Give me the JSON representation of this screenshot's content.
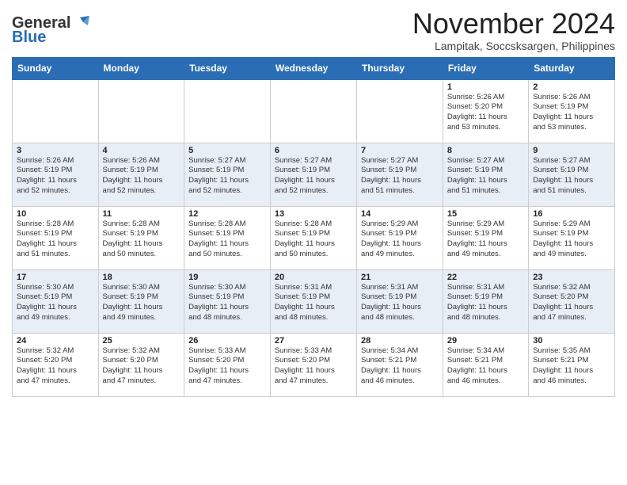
{
  "header": {
    "logo_line1": "General",
    "logo_line2": "Blue",
    "month_title": "November 2024",
    "location": "Lampitak, Soccsksargen, Philippines"
  },
  "columns": [
    "Sunday",
    "Monday",
    "Tuesday",
    "Wednesday",
    "Thursday",
    "Friday",
    "Saturday"
  ],
  "weeks": [
    [
      {
        "day": "",
        "info": ""
      },
      {
        "day": "",
        "info": ""
      },
      {
        "day": "",
        "info": ""
      },
      {
        "day": "",
        "info": ""
      },
      {
        "day": "",
        "info": ""
      },
      {
        "day": "1",
        "info": "Sunrise: 5:26 AM\nSunset: 5:20 PM\nDaylight: 11 hours\nand 53 minutes."
      },
      {
        "day": "2",
        "info": "Sunrise: 5:26 AM\nSunset: 5:19 PM\nDaylight: 11 hours\nand 53 minutes."
      }
    ],
    [
      {
        "day": "3",
        "info": "Sunrise: 5:26 AM\nSunset: 5:19 PM\nDaylight: 11 hours\nand 52 minutes."
      },
      {
        "day": "4",
        "info": "Sunrise: 5:26 AM\nSunset: 5:19 PM\nDaylight: 11 hours\nand 52 minutes."
      },
      {
        "day": "5",
        "info": "Sunrise: 5:27 AM\nSunset: 5:19 PM\nDaylight: 11 hours\nand 52 minutes."
      },
      {
        "day": "6",
        "info": "Sunrise: 5:27 AM\nSunset: 5:19 PM\nDaylight: 11 hours\nand 52 minutes."
      },
      {
        "day": "7",
        "info": "Sunrise: 5:27 AM\nSunset: 5:19 PM\nDaylight: 11 hours\nand 51 minutes."
      },
      {
        "day": "8",
        "info": "Sunrise: 5:27 AM\nSunset: 5:19 PM\nDaylight: 11 hours\nand 51 minutes."
      },
      {
        "day": "9",
        "info": "Sunrise: 5:27 AM\nSunset: 5:19 PM\nDaylight: 11 hours\nand 51 minutes."
      }
    ],
    [
      {
        "day": "10",
        "info": "Sunrise: 5:28 AM\nSunset: 5:19 PM\nDaylight: 11 hours\nand 51 minutes."
      },
      {
        "day": "11",
        "info": "Sunrise: 5:28 AM\nSunset: 5:19 PM\nDaylight: 11 hours\nand 50 minutes."
      },
      {
        "day": "12",
        "info": "Sunrise: 5:28 AM\nSunset: 5:19 PM\nDaylight: 11 hours\nand 50 minutes."
      },
      {
        "day": "13",
        "info": "Sunrise: 5:28 AM\nSunset: 5:19 PM\nDaylight: 11 hours\nand 50 minutes."
      },
      {
        "day": "14",
        "info": "Sunrise: 5:29 AM\nSunset: 5:19 PM\nDaylight: 11 hours\nand 49 minutes."
      },
      {
        "day": "15",
        "info": "Sunrise: 5:29 AM\nSunset: 5:19 PM\nDaylight: 11 hours\nand 49 minutes."
      },
      {
        "day": "16",
        "info": "Sunrise: 5:29 AM\nSunset: 5:19 PM\nDaylight: 11 hours\nand 49 minutes."
      }
    ],
    [
      {
        "day": "17",
        "info": "Sunrise: 5:30 AM\nSunset: 5:19 PM\nDaylight: 11 hours\nand 49 minutes."
      },
      {
        "day": "18",
        "info": "Sunrise: 5:30 AM\nSunset: 5:19 PM\nDaylight: 11 hours\nand 49 minutes."
      },
      {
        "day": "19",
        "info": "Sunrise: 5:30 AM\nSunset: 5:19 PM\nDaylight: 11 hours\nand 48 minutes."
      },
      {
        "day": "20",
        "info": "Sunrise: 5:31 AM\nSunset: 5:19 PM\nDaylight: 11 hours\nand 48 minutes."
      },
      {
        "day": "21",
        "info": "Sunrise: 5:31 AM\nSunset: 5:19 PM\nDaylight: 11 hours\nand 48 minutes."
      },
      {
        "day": "22",
        "info": "Sunrise: 5:31 AM\nSunset: 5:19 PM\nDaylight: 11 hours\nand 48 minutes."
      },
      {
        "day": "23",
        "info": "Sunrise: 5:32 AM\nSunset: 5:20 PM\nDaylight: 11 hours\nand 47 minutes."
      }
    ],
    [
      {
        "day": "24",
        "info": "Sunrise: 5:32 AM\nSunset: 5:20 PM\nDaylight: 11 hours\nand 47 minutes."
      },
      {
        "day": "25",
        "info": "Sunrise: 5:32 AM\nSunset: 5:20 PM\nDaylight: 11 hours\nand 47 minutes."
      },
      {
        "day": "26",
        "info": "Sunrise: 5:33 AM\nSunset: 5:20 PM\nDaylight: 11 hours\nand 47 minutes."
      },
      {
        "day": "27",
        "info": "Sunrise: 5:33 AM\nSunset: 5:20 PM\nDaylight: 11 hours\nand 47 minutes."
      },
      {
        "day": "28",
        "info": "Sunrise: 5:34 AM\nSunset: 5:21 PM\nDaylight: 11 hours\nand 46 minutes."
      },
      {
        "day": "29",
        "info": "Sunrise: 5:34 AM\nSunset: 5:21 PM\nDaylight: 11 hours\nand 46 minutes."
      },
      {
        "day": "30",
        "info": "Sunrise: 5:35 AM\nSunset: 5:21 PM\nDaylight: 11 hours\nand 46 minutes."
      }
    ]
  ]
}
